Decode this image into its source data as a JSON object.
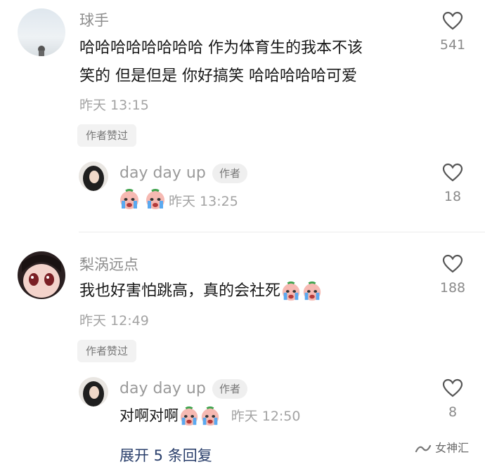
{
  "comments": [
    {
      "username": "球手",
      "text_line1": "哈哈哈哈哈哈哈哈 作为体育生的我本不该",
      "text_line2": "笑的   但是但是 你好搞笑 哈哈哈哈哈可爱",
      "time": "昨天 13:15",
      "author_badge": "作者赞过",
      "likes": "541",
      "reply": {
        "username": "day day up",
        "author_tag": "作者",
        "text": "",
        "emojis": [
          "crying-face-emoji",
          "crying-face-emoji"
        ],
        "time": "昨天 13:25",
        "likes": "18"
      }
    },
    {
      "username": "梨涡远点",
      "text": "我也好害怕跳高，真的会社死",
      "emojis": [
        "crying-face-emoji",
        "crying-face-emoji"
      ],
      "time": "昨天 12:49",
      "author_badge": "作者赞过",
      "likes": "188",
      "reply": {
        "username": "day day up",
        "author_tag": "作者",
        "text": "对啊对啊",
        "emojis": [
          "crying-face-emoji",
          "crying-face-emoji"
        ],
        "time": "昨天 12:50",
        "likes": "8"
      }
    }
  ],
  "expand_replies": "展开 5 条回复",
  "watermark": "女神汇",
  "icons": {
    "like": "heart-outline-icon",
    "watermark": "wechat-channel-icon"
  }
}
